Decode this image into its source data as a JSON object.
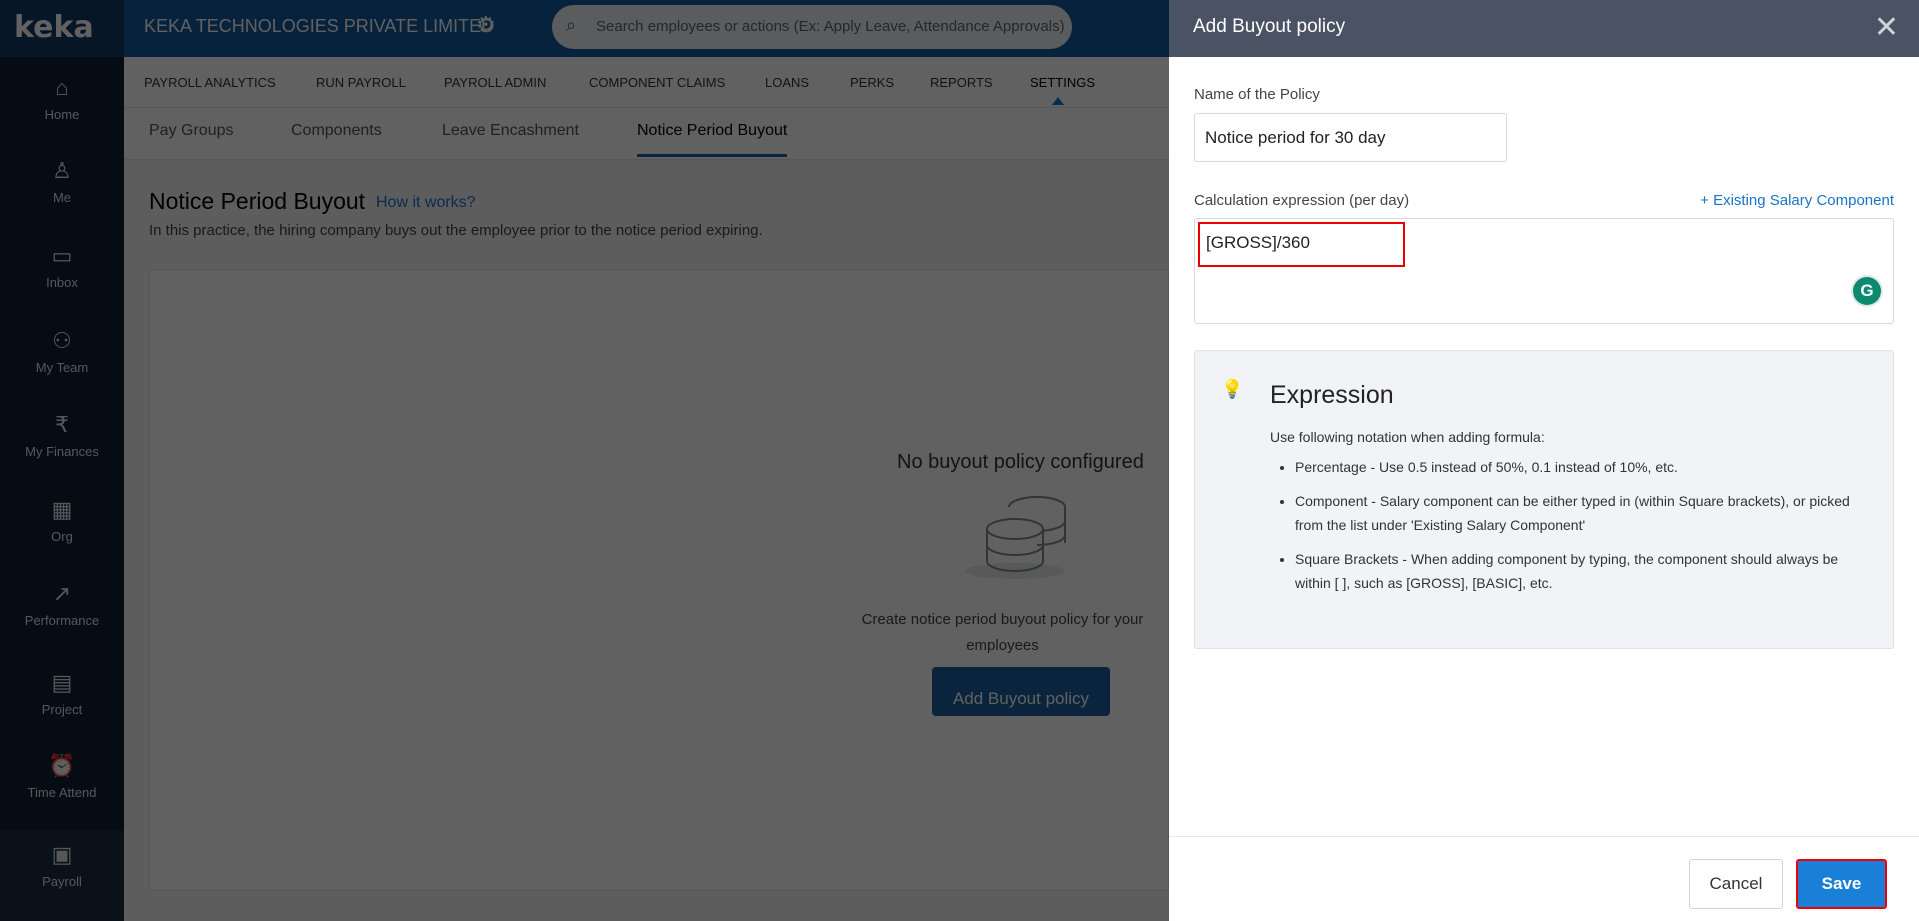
{
  "app": {
    "logo": "keka",
    "company": "KEKA TECHNOLOGIES PRIVATE LIMITED",
    "search_placeholder": "Search employees or actions (Ex: Apply Leave, Attendance Approvals)"
  },
  "sidebar": {
    "items": [
      {
        "label": "Home",
        "icon": "⌂"
      },
      {
        "label": "Me",
        "icon": "♙"
      },
      {
        "label": "Inbox",
        "icon": "▭"
      },
      {
        "label": "My Team",
        "icon": "⚇"
      },
      {
        "label": "My Finances",
        "icon": "₹"
      },
      {
        "label": "Org",
        "icon": "▦"
      },
      {
        "label": "Performance",
        "icon": "↗"
      },
      {
        "label": "Project",
        "icon": "▤"
      },
      {
        "label": "Time Attend",
        "icon": "⏰"
      },
      {
        "label": "Payroll",
        "icon": "▣"
      }
    ]
  },
  "nav": {
    "tabs": [
      "PAYROLL ANALYTICS",
      "RUN PAYROLL",
      "PAYROLL ADMIN",
      "COMPONENT CLAIMS",
      "LOANS",
      "PERKS",
      "REPORTS",
      "SETTINGS"
    ],
    "active": "SETTINGS"
  },
  "subnav": {
    "tabs": [
      "Pay Groups",
      "Components",
      "Leave Encashment",
      "Notice Period Buyout"
    ],
    "active": "Notice Period Buyout"
  },
  "page": {
    "title": "Notice Period Buyout",
    "how_link": "How it works?",
    "description": "In this practice, the hiring company buys out the employee prior to the notice period expiring.",
    "empty_title": "No buyout policy configured",
    "empty_desc": "Create notice period buyout policy for your employees",
    "add_button": "Add Buyout policy"
  },
  "panel": {
    "title": "Add Buyout policy",
    "name_label": "Name of the Policy",
    "name_value": "Notice period for 30 day",
    "calc_label": "Calculation expression (per day)",
    "existing_link": "+ Existing Salary Component",
    "calc_value": "[GROSS]/360",
    "expression": {
      "title": "Expression",
      "intro": "Use following notation when adding formula:",
      "items": [
        "Percentage - Use 0.5 instead of 50%, 0.1 instead of 10%, etc.",
        "Component - Salary component can be either typed in (within Square brackets), or picked from the list under 'Existing Salary Component'",
        "Square Brackets - When adding component by typing, the component should always be within [ ], such as [GROSS], [BASIC], etc."
      ]
    },
    "cancel": "Cancel",
    "save": "Save"
  }
}
